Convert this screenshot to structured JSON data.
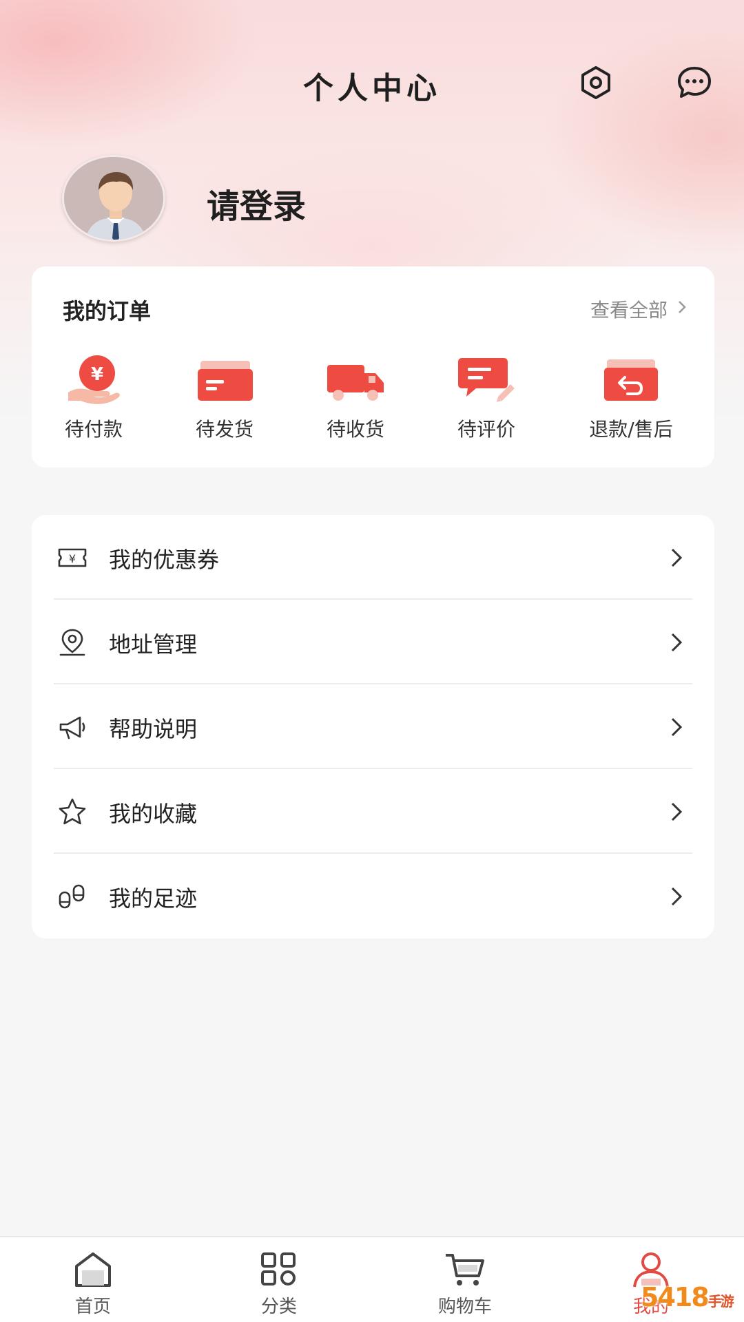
{
  "header": {
    "title": "个人中心"
  },
  "profile": {
    "login_prompt": "请登录"
  },
  "orders": {
    "title": "我的订单",
    "view_all": "查看全部",
    "items": [
      {
        "label": "待付款",
        "icon": "pending-payment-icon"
      },
      {
        "label": "待发货",
        "icon": "pending-shipment-icon"
      },
      {
        "label": "待收货",
        "icon": "delivery-truck-icon"
      },
      {
        "label": "待评价",
        "icon": "review-icon"
      },
      {
        "label": "退款/售后",
        "icon": "refund-icon"
      }
    ]
  },
  "menu": [
    {
      "label": "我的优惠券",
      "icon": "coupon-icon"
    },
    {
      "label": "地址管理",
      "icon": "location-icon"
    },
    {
      "label": "帮助说明",
      "icon": "megaphone-icon"
    },
    {
      "label": "我的收藏",
      "icon": "star-icon"
    },
    {
      "label": "我的足迹",
      "icon": "footprint-icon"
    }
  ],
  "bottom_nav": [
    {
      "label": "首页",
      "icon": "home-icon"
    },
    {
      "label": "分类",
      "icon": "category-icon"
    },
    {
      "label": "购物车",
      "icon": "cart-icon"
    },
    {
      "label": "我的",
      "icon": "user-icon",
      "active": true
    }
  ],
  "watermark": {
    "text": "5418",
    "sub": "手游网"
  },
  "colors": {
    "accent": "#e34a43",
    "order_icon": "#ee4c42"
  }
}
